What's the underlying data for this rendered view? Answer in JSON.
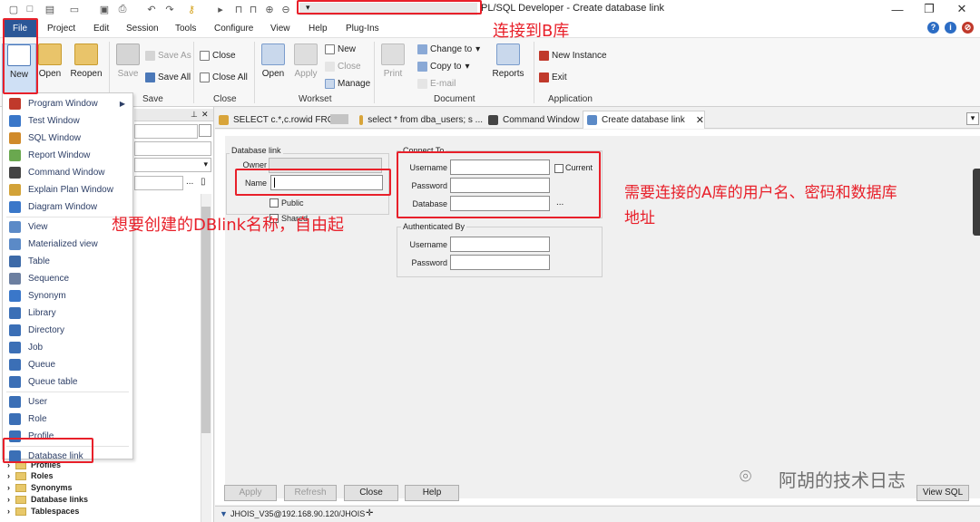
{
  "window": {
    "title": "PL/SQL Developer - Create database link",
    "qa_hint": "▾"
  },
  "menu": [
    "File",
    "Project",
    "Edit",
    "Session",
    "Tools",
    "Configure",
    "View",
    "Help",
    "Plug-Ins"
  ],
  "ribbon": {
    "file": {
      "new": "New",
      "open": "Open",
      "reopen": "Reopen"
    },
    "save": {
      "save": "Save",
      "save_as": "Save As",
      "save_all": "Save All",
      "group": "Save"
    },
    "close": {
      "close": "Close",
      "close_all": "Close All",
      "group": "Close"
    },
    "worksets": {
      "open": "Open",
      "apply": "Apply",
      "new": "New",
      "close": "Close",
      "manage": "Manage",
      "group": "Workset"
    },
    "document": {
      "print": "Print",
      "change_to": "Change to",
      "copy_to": "Copy to",
      "email": "E-mail",
      "reports": "Reports",
      "group": "Document"
    },
    "application": {
      "new_instance": "New Instance",
      "exit": "Exit",
      "group": "Application"
    }
  },
  "file_menu": [
    {
      "label": "Program Window",
      "color": "#c0392b",
      "submenu": true
    },
    {
      "label": "Test Window",
      "color": "#3a77c9"
    },
    {
      "label": "SQL Window",
      "color": "#d08a2a"
    },
    {
      "label": "Report Window",
      "color": "#6aa84f"
    },
    {
      "label": "Command Window",
      "color": "#444444"
    },
    {
      "label": "Explain Plan Window",
      "color": "#d2a238"
    },
    {
      "label": "Diagram Window",
      "color": "#3a77c9"
    },
    {
      "sep": true
    },
    {
      "label": "View",
      "color": "#5b8ac7"
    },
    {
      "label": "Materialized view",
      "color": "#5b8ac7"
    },
    {
      "label": "Table",
      "color": "#3d6aa8"
    },
    {
      "label": "Sequence",
      "color": "#6c7fa0"
    },
    {
      "label": "Synonym",
      "color": "#3a77c9"
    },
    {
      "label": "Library",
      "color": "#3b6fb6"
    },
    {
      "label": "Directory",
      "color": "#3b6fb6"
    },
    {
      "label": "Job",
      "color": "#3b6fb6"
    },
    {
      "label": "Queue",
      "color": "#3b6fb6"
    },
    {
      "label": "Queue table",
      "color": "#3b6fb6"
    },
    {
      "sep": true
    },
    {
      "label": "User",
      "color": "#3b6fb6"
    },
    {
      "label": "Role",
      "color": "#3b6fb6"
    },
    {
      "label": "Profile",
      "color": "#3b6fb6"
    },
    {
      "sep": true
    },
    {
      "label": "Database link",
      "color": "#3b6fb6"
    }
  ],
  "tree": [
    "Profiles",
    "Roles",
    "Synonyms",
    "Database links",
    "Tablespaces"
  ],
  "tabs": [
    {
      "label": "SELECT c.*,c.rowid FROM",
      "active": false
    },
    {
      "label": "select * from dba_users; s ...",
      "active": false
    },
    {
      "label": "Command Window",
      "active": false
    },
    {
      "label": "Create database link",
      "active": true
    }
  ],
  "form": {
    "dblink_legend": "Database link",
    "owner_label": "Owner",
    "name_label": "Name",
    "name_value": "",
    "public_label": "Public",
    "shared_label": "Shared",
    "connect_legend": "Connect To",
    "username_label": "Username",
    "password_label": "Password",
    "database_label": "Database",
    "current_label": "Current",
    "ellipsis": "...",
    "auth_legend": "Authenticated By",
    "auth_username_label": "Username",
    "auth_password_label": "Password"
  },
  "buttons": {
    "apply": "Apply",
    "refresh": "Refresh",
    "close": "Close",
    "help": "Help",
    "view_sql": "View SQL"
  },
  "status": {
    "connection": "JHOIS_V35@192.168.90.120/JHOIS"
  },
  "annotations": {
    "top": "连接到B库",
    "left": "想要创建的DBlink名称，自由起",
    "right_line1": "需要连接的A库的用户名、密码和数据库",
    "right_line2": "地址"
  },
  "watermark": "阿胡的技术日志"
}
